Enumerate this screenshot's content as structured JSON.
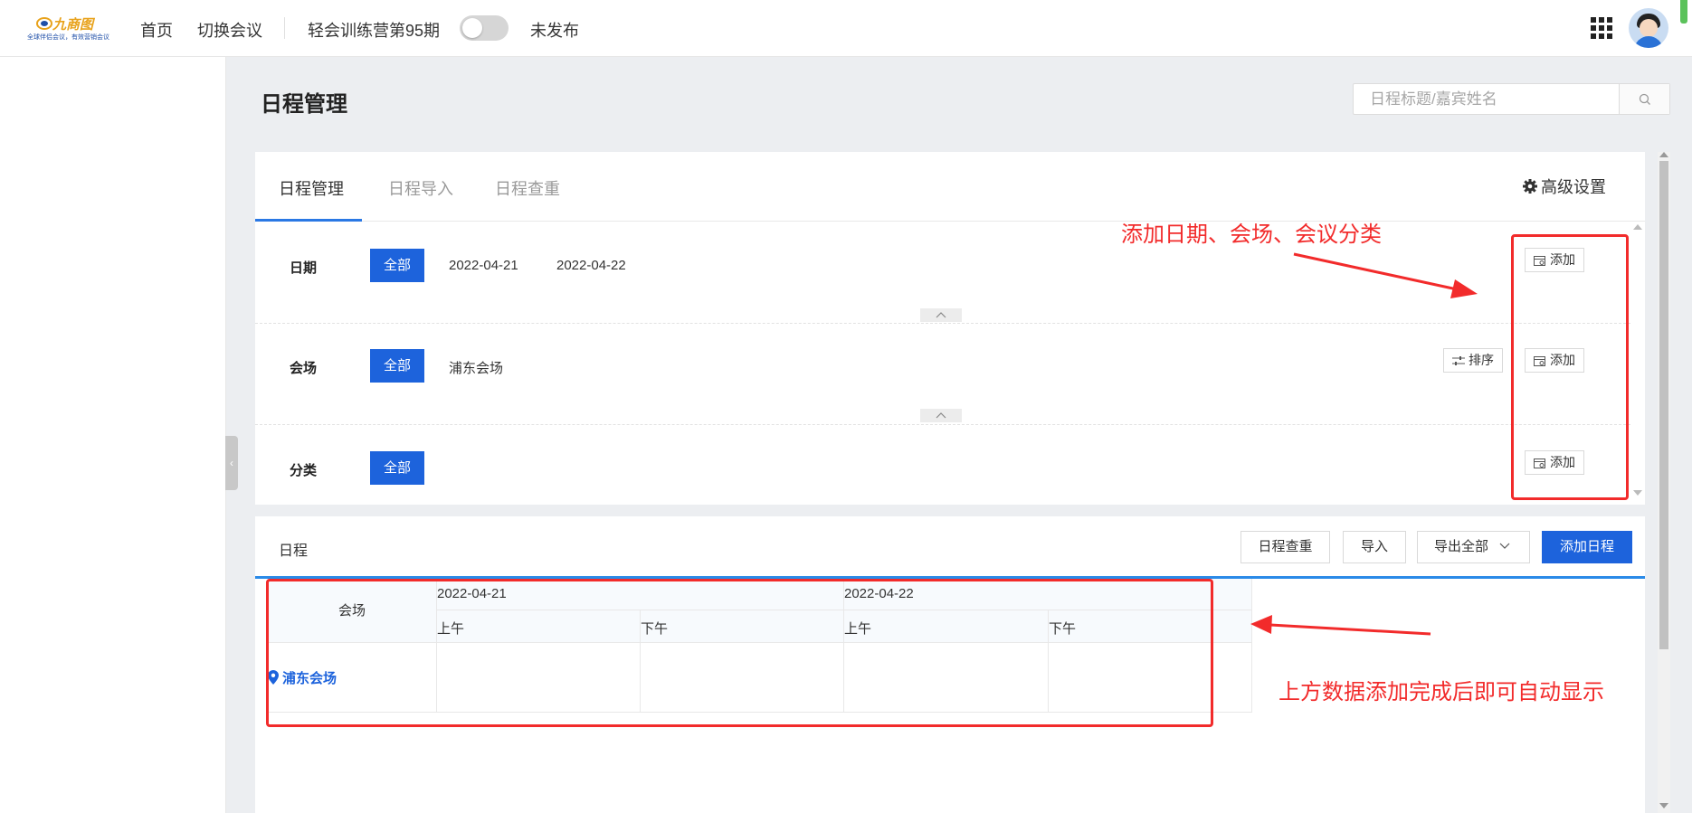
{
  "topbar": {
    "logo_brand": "九商图",
    "logo_tagline": "全球伴侣会议，有效营销会议",
    "nav_home": "首页",
    "nav_switch": "切换会议",
    "meeting_name": "轻会训练营第95期",
    "publish_status": "未发布",
    "publish_toggle_on": false
  },
  "page": {
    "title": "日程管理"
  },
  "search": {
    "placeholder": "日程标题/嘉宾姓名"
  },
  "tabs": [
    {
      "label": "日程管理",
      "active": true
    },
    {
      "label": "日程导入",
      "active": false
    },
    {
      "label": "日程查重",
      "active": false
    }
  ],
  "advanced_settings_label": "高级设置",
  "filters": {
    "date": {
      "label": "日期",
      "all_label": "全部",
      "items": [
        "2022-04-21",
        "2022-04-22"
      ],
      "add_label": "添加"
    },
    "venue": {
      "label": "会场",
      "all_label": "全部",
      "items": [
        "浦东会场"
      ],
      "sort_label": "排序",
      "add_label": "添加"
    },
    "category": {
      "label": "分类",
      "all_label": "全部",
      "items": [],
      "add_label": "添加"
    }
  },
  "schedule": {
    "title": "日程",
    "btn_dedupe": "日程查重",
    "btn_import": "导入",
    "btn_export": "导出全部",
    "btn_add": "添加日程",
    "venue_header": "会场",
    "dates": [
      {
        "date": "2022-04-21",
        "slots": [
          "上午",
          "下午"
        ]
      },
      {
        "date": "2022-04-22",
        "slots": [
          "上午",
          "下午"
        ]
      }
    ],
    "rows": [
      {
        "venue": "浦东会场"
      }
    ]
  },
  "annotations": {
    "top": "添加日期、会场、会议分类",
    "bottom": "上方数据添加完成后即可自动显示",
    "color": "#f22b2b"
  },
  "colors": {
    "primary": "#1d63dc",
    "tab_underline": "#2a78e4"
  }
}
